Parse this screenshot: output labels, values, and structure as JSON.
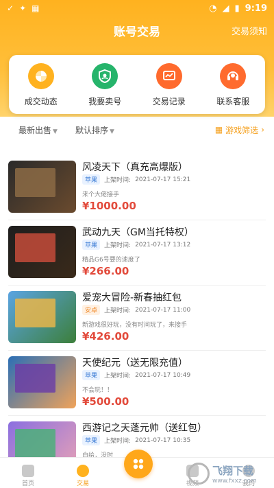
{
  "status_bar": {
    "time": "9:19",
    "left_icons": [
      "check-icon",
      "bug-icon",
      "grid-icon"
    ],
    "right_icons": [
      "wifi-icon",
      "signal-icon",
      "battery-icon"
    ]
  },
  "header": {
    "title": "账号交易",
    "right_link": "交易须知"
  },
  "quick_actions": [
    {
      "label": "成交动态",
      "icon": "pinwheel-icon",
      "color": "#ffb21f"
    },
    {
      "label": "我要卖号",
      "icon": "user-shield-icon",
      "color": "#26b46b"
    },
    {
      "label": "交易记录",
      "icon": "chart-record-icon",
      "color": "#ff6a2d"
    },
    {
      "label": "联系客服",
      "icon": "headset-icon",
      "color": "#ff6b2e"
    }
  ],
  "filters": {
    "sort_new": "最新出售",
    "sort_default": "默认排序",
    "game_filter": "游戏筛选"
  },
  "listings": [
    {
      "title": "风凌天下（真充高爆版）",
      "platform": "苹果",
      "platform_type": "ios",
      "listed_label": "上架时间:",
      "listed_time": "2021-07-17 15:21",
      "desc": "来个大佬接手",
      "price": "¥1000.00"
    },
    {
      "title": "武动九天（GM当托特权）",
      "platform": "苹果",
      "platform_type": "ios",
      "listed_label": "上架时间:",
      "listed_time": "2021-07-17 13:12",
      "desc": "精品G6号要的速度了",
      "price": "¥266.00"
    },
    {
      "title": "爱宠大冒险-新春抽红包",
      "platform": "安卓",
      "platform_type": "android",
      "listed_label": "上架时间:",
      "listed_time": "2021-07-17 11:00",
      "desc": "新游戏很好玩，没有时间玩了，来接手",
      "price": "¥426.00"
    },
    {
      "title": "天使纪元（送无限充值）",
      "platform": "苹果",
      "platform_type": "ios",
      "listed_label": "上架时间:",
      "listed_time": "2021-07-17 10:49",
      "desc": "不会玩！！",
      "price": "¥500.00"
    },
    {
      "title": "西游记之天蓬元帅（送红包）",
      "platform": "苹果",
      "platform_type": "ios",
      "listed_label": "上架时间:",
      "listed_time": "2021-07-17 10:35",
      "desc": "白给，没时",
      "price": ""
    }
  ],
  "tab_bar": {
    "tabs": [
      {
        "label": "首页",
        "icon": "home-icon"
      },
      {
        "label": "交易",
        "icon": "trade-icon",
        "active": true
      },
      {
        "label": "视频",
        "icon": "video-icon"
      },
      {
        "label": "我的",
        "icon": "profile-icon"
      }
    ],
    "center_icon": "grid-menu-icon"
  },
  "watermark": {
    "brand": "飞翔下载",
    "url": "www.fxxz.com"
  }
}
